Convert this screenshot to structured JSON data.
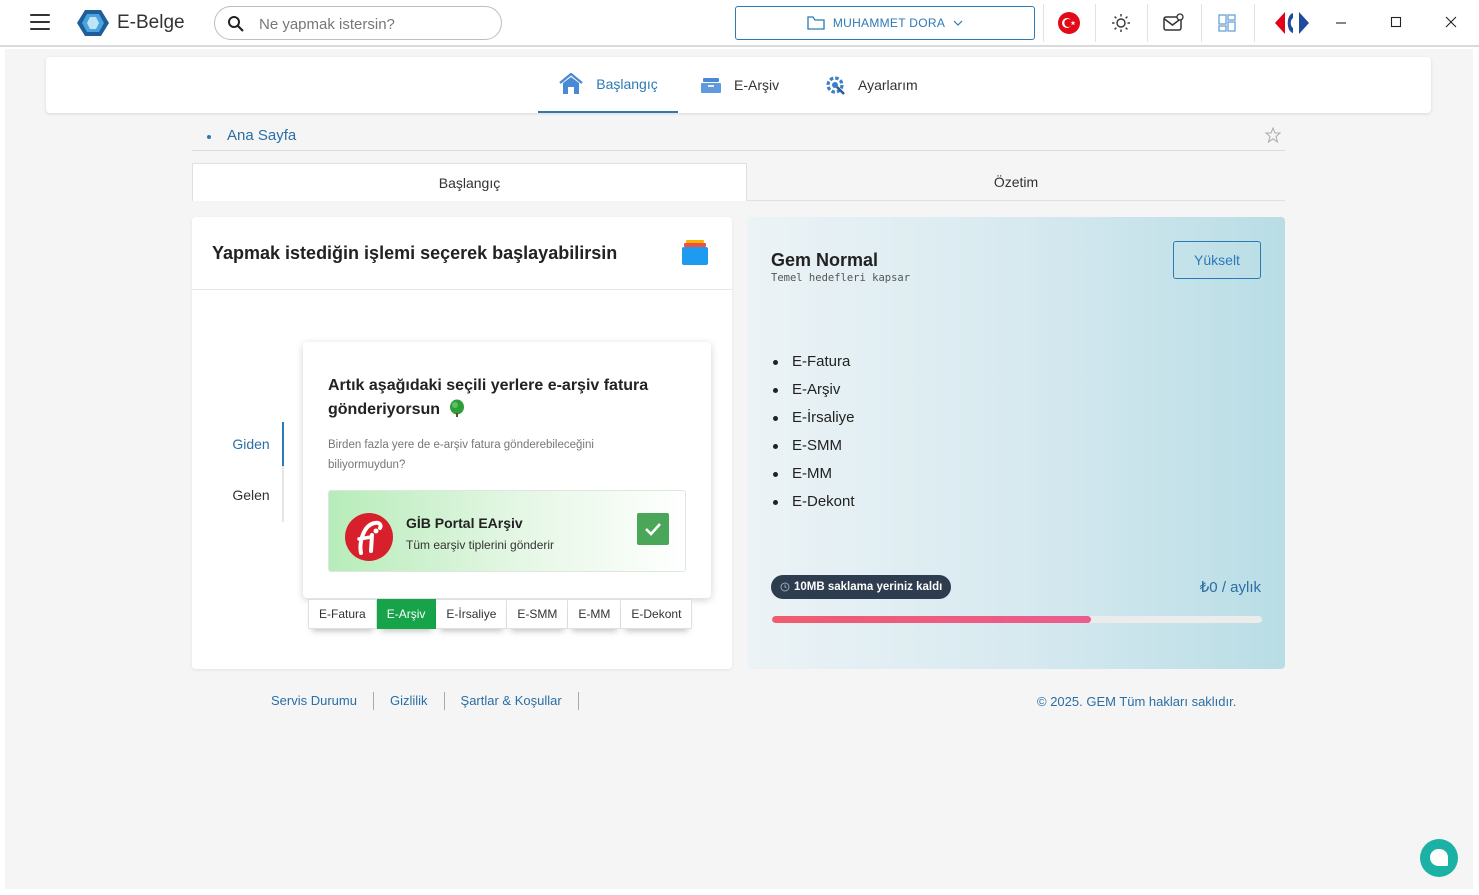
{
  "app": {
    "brand": "E-Belge"
  },
  "search": {
    "placeholder": "Ne yapmak istersin?"
  },
  "user": {
    "name": "MUHAMMET DORA"
  },
  "nav": {
    "tabs": [
      {
        "label": "Başlangıç",
        "icon": "home-icon"
      },
      {
        "label": "E-Arşiv",
        "icon": "archive-icon"
      },
      {
        "label": "Ayarlarım",
        "icon": "settings-icon"
      }
    ]
  },
  "breadcrumb": {
    "label": "Ana Sayfa"
  },
  "subtabs": [
    {
      "label": "Başlangıç"
    },
    {
      "label": "Özetim"
    }
  ],
  "left": {
    "title": "Yapmak istediğin işlemi seçerek başlayabilirsin",
    "side_tabs": [
      {
        "label": "Giden"
      },
      {
        "label": "Gelen"
      }
    ],
    "popup": {
      "title": "Artık aşağıdaki seçili yerlere e-arşiv fatura gönderiyorsun",
      "desc": "Birden fazla yere de e-arşiv fatura gönderebileceğini biliyormuydun?",
      "provider": {
        "name": "GİB Portal EArşiv",
        "desc": "Tüm earşiv tiplerini gönderir",
        "checked": true
      }
    },
    "doc_tabs": [
      {
        "label": "E-Fatura"
      },
      {
        "label": "E-Arşiv",
        "active": true
      },
      {
        "label": "E-İrsaliye"
      },
      {
        "label": "E-SMM"
      },
      {
        "label": "E-MM"
      },
      {
        "label": "E-Dekont"
      }
    ]
  },
  "plan": {
    "name": "Gem Normal",
    "subtitle": "Temel hedefleri kapsar",
    "upgrade_label": "Yükselt",
    "features": [
      "E-Fatura",
      "E-Arşiv",
      "E-İrsaliye",
      "E-SMM",
      "E-MM",
      "E-Dekont"
    ],
    "storage_label": "10MB saklama yeriniz kaldı",
    "price": "₺0 / aylık",
    "usage_fraction": 0.65
  },
  "footer": {
    "links": [
      "Servis Durumu",
      "Gizlilik",
      "Şartlar & Koşullar"
    ],
    "copyright": "© 2025. GEM Tüm hakları saklıdır."
  },
  "colors": {
    "accent": "#2a7ab8",
    "success": "#16a34a",
    "chat": "#1bb2a5"
  }
}
